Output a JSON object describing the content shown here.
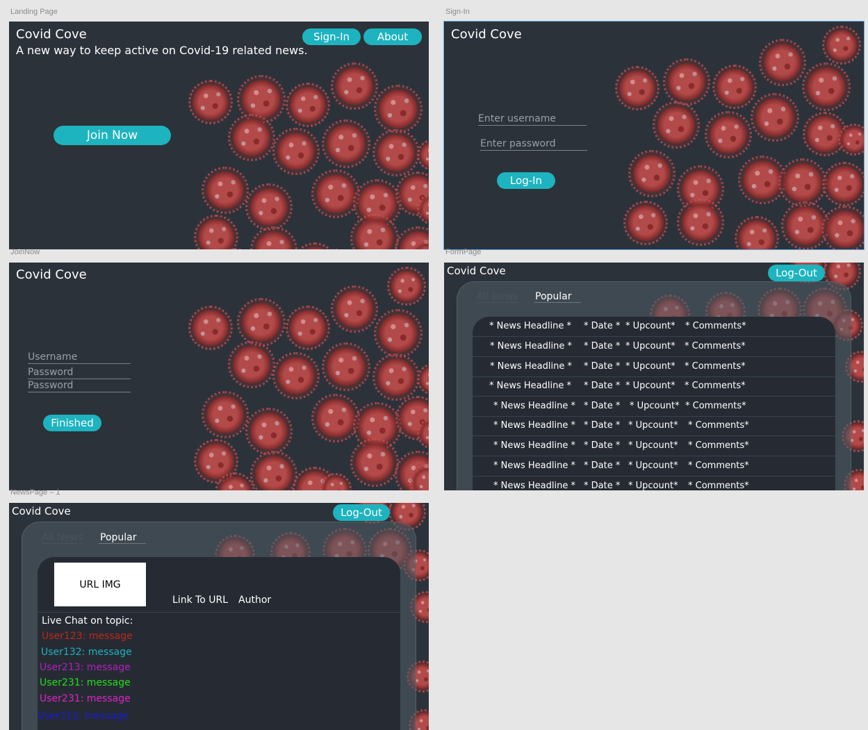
{
  "frames": {
    "landing": {
      "label": "Landing Page"
    },
    "signin": {
      "label": "Sign-In"
    },
    "joinnow": {
      "label": "JoinNow"
    },
    "formpage": {
      "label": "FormPage"
    },
    "newspage": {
      "label": "NewsPage – 1"
    }
  },
  "brand": "Covid Cove",
  "landing": {
    "tagline": "A new way to keep active on Covid-19 related news.",
    "signin_label": "Sign-In",
    "about_label": "About",
    "join_label": "Join Now"
  },
  "signin": {
    "username_placeholder": "Enter username",
    "password_placeholder": "Enter password",
    "login_label": "Log-In"
  },
  "joinnow": {
    "username_placeholder": "Username",
    "password_placeholder": "Password",
    "password_confirm_placeholder": "Password",
    "finished_label": "Finished"
  },
  "formpage": {
    "logout_label": "Log-Out",
    "tabs": [
      "All News",
      "Popular"
    ],
    "columns": [
      "* News Headline *",
      "* Date *",
      "* Upcount*",
      "* Comments*"
    ],
    "rows": [
      [
        "* News Headline *",
        "* Date *",
        "* Upcount*",
        "* Comments*"
      ],
      [
        "* News Headline *",
        "* Date *",
        "* Upcount*",
        "* Comments*"
      ],
      [
        "* News Headline *",
        "* Date *",
        "* Upcount*",
        "* Comments*"
      ],
      [
        "* News Headline *",
        "* Date *",
        "* Upcount*",
        "* Comments*"
      ],
      [
        "* News Headline *",
        "* Date *",
        "* Upcount*",
        "* Comments*"
      ],
      [
        "* News Headline *",
        "* Date *",
        "* Upcount*",
        "* Comments*"
      ],
      [
        "* News Headline *",
        "* Date *",
        "* Upcount*",
        "* Comments*"
      ],
      [
        "* News Headline *",
        "* Date *",
        "* Upcount*",
        "* Comments*"
      ],
      [
        "* News Headline *",
        "* Date *",
        "* Upcount*",
        "* Comments*"
      ]
    ]
  },
  "newspage": {
    "logout_label": "Log-Out",
    "tabs": [
      "All News",
      "Popular"
    ],
    "image_label": "URL IMG",
    "link_label": "Link To URL",
    "author_label": "Author",
    "chat_title": "Live Chat on topic:",
    "chat": [
      {
        "text": "User123: message",
        "color": "#c0261a"
      },
      {
        "text": "User132: message",
        "color": "#1db3bf"
      },
      {
        "text": "User213: message",
        "color": "#b21fbf"
      },
      {
        "text": "User231: message",
        "color": "#22e01c"
      },
      {
        "text": "User231: message",
        "color": "#e023c9"
      },
      {
        "text": "User312: message",
        "color": "#1a1ad6"
      }
    ]
  },
  "colors": {
    "accent": "#1db3bf",
    "background": "#2c323a",
    "canvas": "#e6e6e6"
  }
}
